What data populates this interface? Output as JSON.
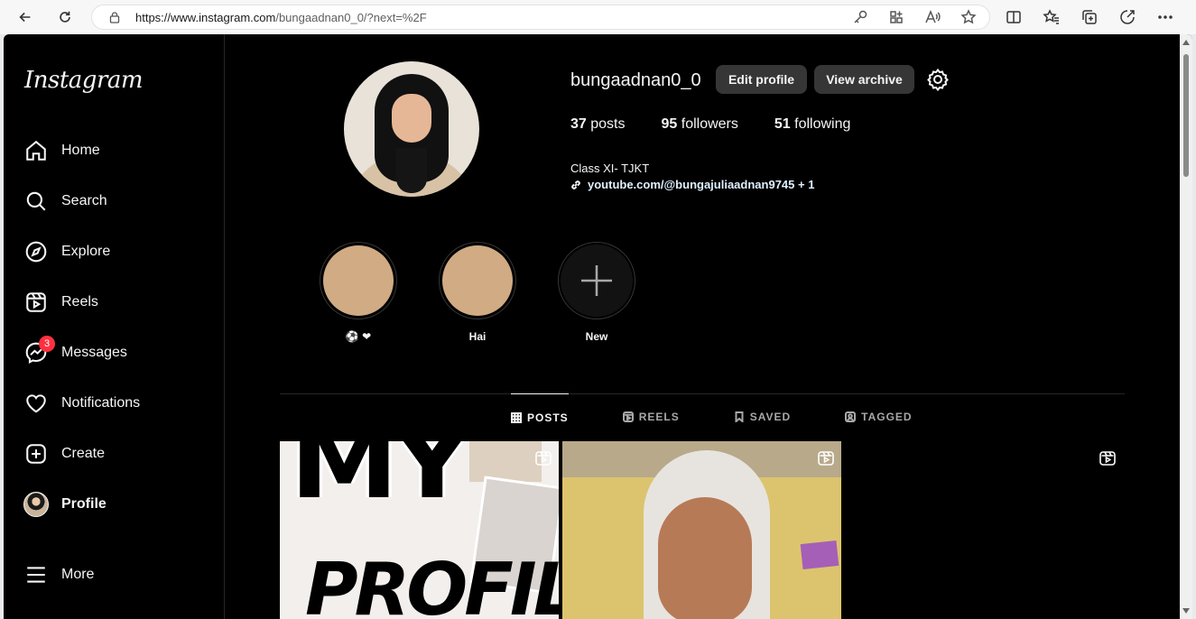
{
  "browser": {
    "url_host": "https://www.instagram.com",
    "url_path": "/bungaadnan0_0/?next=%2F"
  },
  "sidebar": {
    "logo": "Instagram",
    "items": [
      {
        "label": "Home",
        "icon": "home-icon"
      },
      {
        "label": "Search",
        "icon": "search-icon"
      },
      {
        "label": "Explore",
        "icon": "compass-icon"
      },
      {
        "label": "Reels",
        "icon": "reels-icon"
      },
      {
        "label": "Messages",
        "icon": "messenger-icon",
        "badge": "3"
      },
      {
        "label": "Notifications",
        "icon": "heart-icon"
      },
      {
        "label": "Create",
        "icon": "plus-square-icon"
      },
      {
        "label": "Profile",
        "icon": "avatar"
      },
      {
        "label": "More",
        "icon": "menu-icon"
      }
    ]
  },
  "profile": {
    "username": "bungaadnan0_0",
    "edit_label": "Edit profile",
    "archive_label": "View archive",
    "posts_count": "37",
    "posts_label": "posts",
    "followers_count": "95",
    "followers_label": "followers",
    "following_count": "51",
    "following_label": "following",
    "bio": "Class XI- TJKT",
    "link": "youtube.com/@bungajuliaadnan9745 + 1"
  },
  "highlights": [
    {
      "label": "⚽ ❤"
    },
    {
      "label": "Hai"
    },
    {
      "label": "New"
    }
  ],
  "tabs": [
    {
      "label": "POSTS",
      "active": true
    },
    {
      "label": "REELS",
      "active": false
    },
    {
      "label": "SAVED",
      "active": false
    },
    {
      "label": "TAGGED",
      "active": false
    }
  ],
  "posts": [
    {
      "text_top": "MY",
      "text_bottom": "PROFILE"
    }
  ],
  "colors": {
    "background": "#000000",
    "button": "#363636",
    "badge": "#ff3040",
    "highlight_disc": "#d0ab83"
  }
}
